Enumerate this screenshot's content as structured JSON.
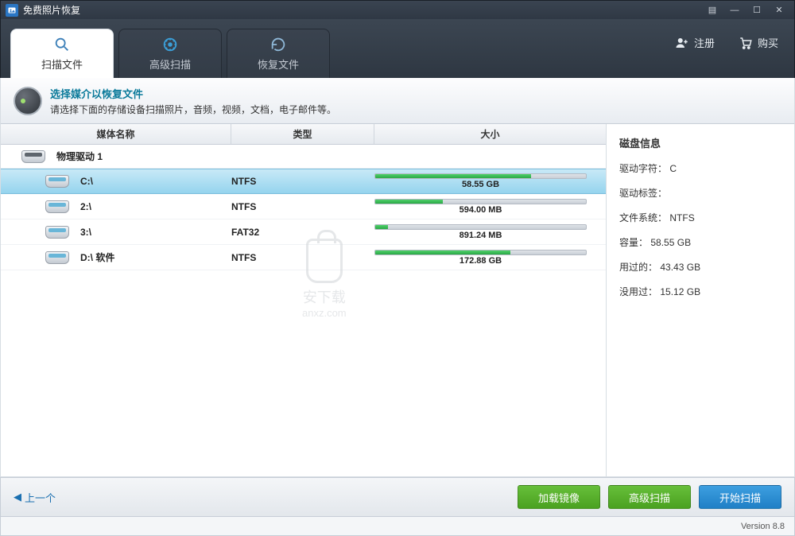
{
  "title": "免费照片恢复",
  "topActions": {
    "register": "注册",
    "buy": "购买"
  },
  "tabs": [
    {
      "label": "扫描文件",
      "active": true
    },
    {
      "label": "高级扫描",
      "active": false
    },
    {
      "label": "恢复文件",
      "active": false
    }
  ],
  "instruction": {
    "headline": "选择媒介以恢复文件",
    "sub": "请选择下面的存储设备扫描照片，音频，视频，文档，电子邮件等。"
  },
  "columns": {
    "name": "媒体名称",
    "type": "类型",
    "size": "大小"
  },
  "group": "物理驱动 1",
  "drives": [
    {
      "name": "C:\\",
      "type": "NTFS",
      "size": "58.55 GB",
      "used_pct": 74,
      "selected": true
    },
    {
      "name": "2:\\",
      "type": "NTFS",
      "size": "594.00 MB",
      "used_pct": 32,
      "selected": false
    },
    {
      "name": "3:\\",
      "type": "FAT32",
      "size": "891.24 MB",
      "used_pct": 6,
      "selected": false
    },
    {
      "name": "D:\\ 软件",
      "type": "NTFS",
      "size": "172.88 GB",
      "used_pct": 64,
      "selected": false
    }
  ],
  "info": {
    "title": "磁盘信息",
    "rows": [
      {
        "label": "驱动字符",
        "value": "C"
      },
      {
        "label": "驱动标签",
        "value": ""
      },
      {
        "label": "文件系统",
        "value": "NTFS"
      },
      {
        "label": "容量",
        "value": "58.55 GB"
      },
      {
        "label": "用过的",
        "value": "43.43 GB"
      },
      {
        "label": "没用过",
        "value": "15.12 GB"
      }
    ]
  },
  "footer": {
    "back": "上一个",
    "loadImage": "加载镜像",
    "advScan": "高级扫描",
    "startScan": "开始扫描"
  },
  "version": "Version 8.8",
  "watermark": {
    "line1": "安下载",
    "line2": "anxz.com"
  }
}
